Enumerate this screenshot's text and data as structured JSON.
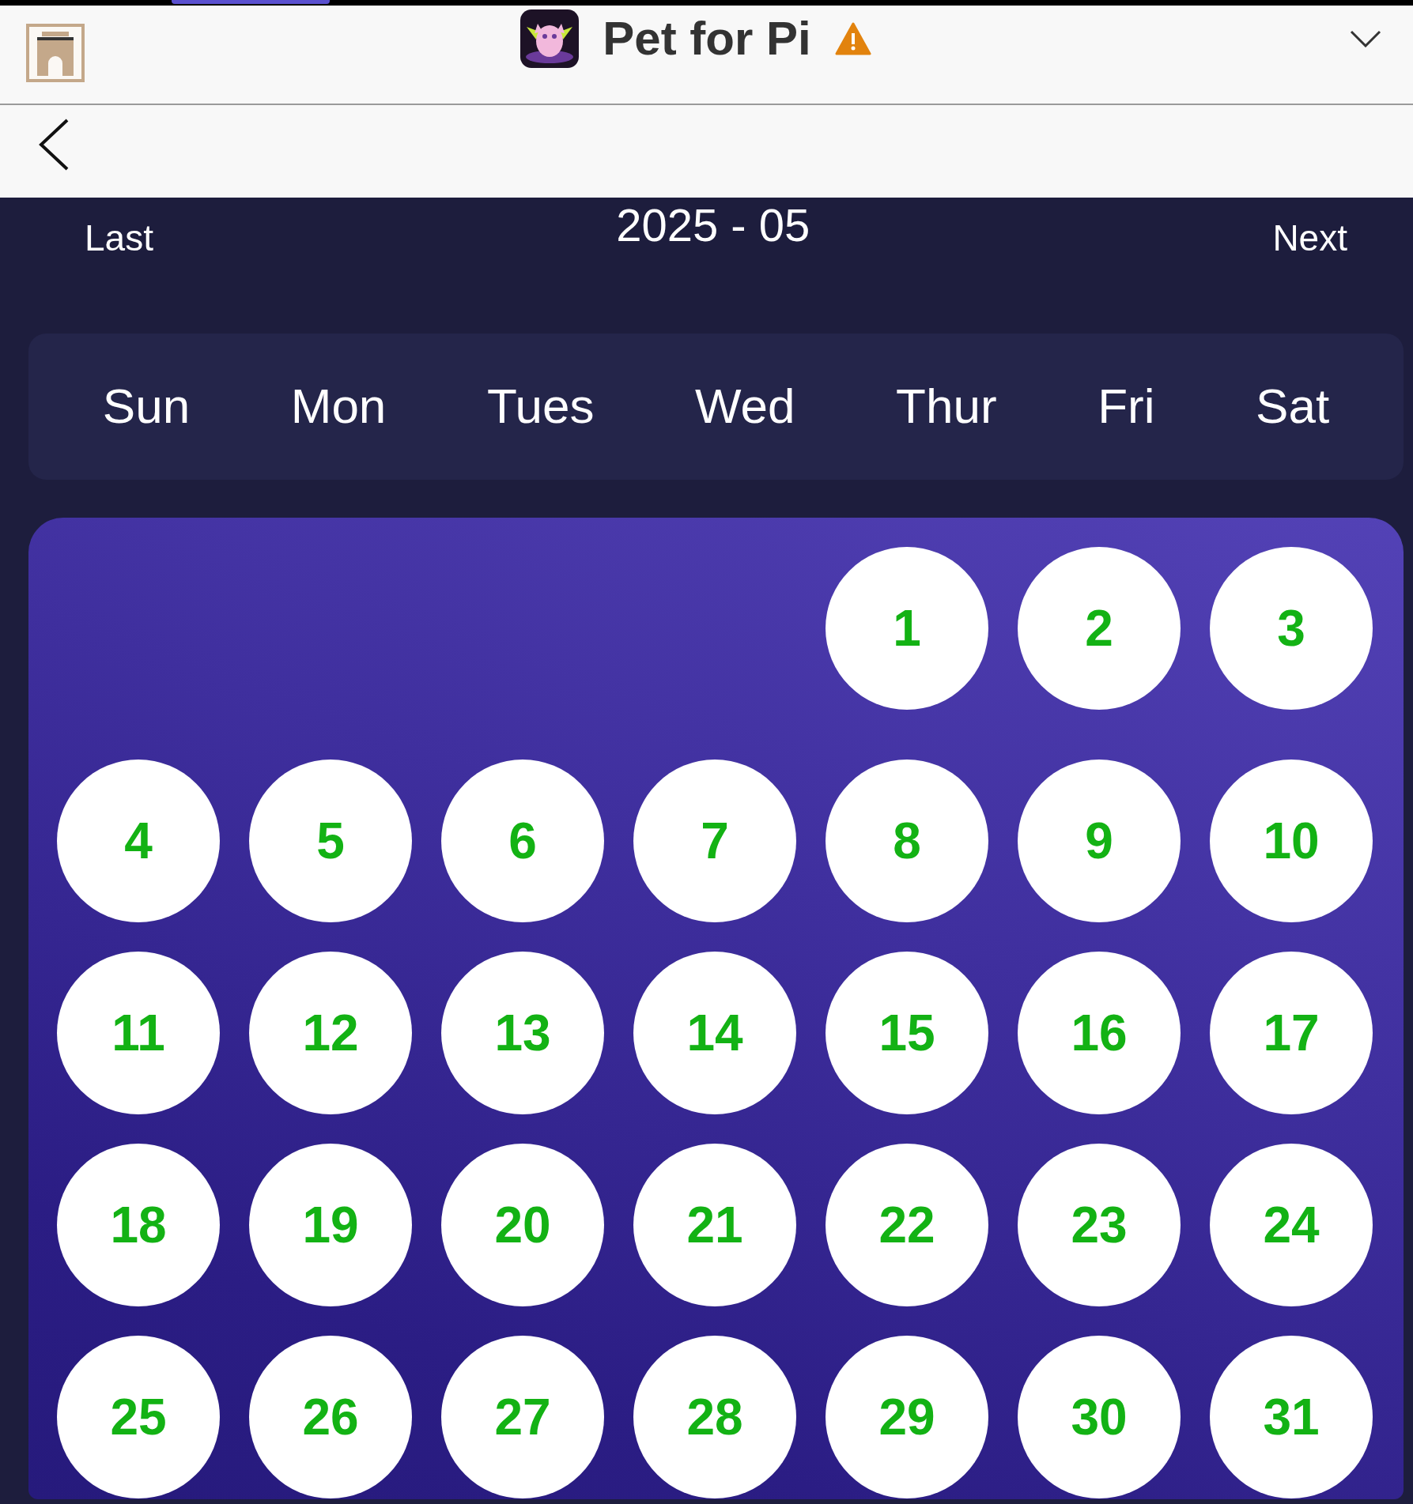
{
  "app_bar": {
    "title": "Pet for Pi"
  },
  "calendar": {
    "previous": "Last",
    "month": "2025 - 05",
    "next": "Next",
    "weekdays": [
      "Sun",
      "Mon",
      "Tues",
      "Wed",
      "Thur",
      "Fri",
      "Sat"
    ],
    "weeks": [
      [
        "1",
        "2",
        "3"
      ],
      [
        "4",
        "5",
        "6",
        "7",
        "8",
        "9",
        "10"
      ],
      [
        "11",
        "12",
        "13",
        "14",
        "15",
        "16",
        "17"
      ],
      [
        "18",
        "19",
        "20",
        "21",
        "22",
        "23",
        "24"
      ],
      [
        "25",
        "26",
        "27",
        "28",
        "29",
        "30",
        "31"
      ]
    ]
  }
}
